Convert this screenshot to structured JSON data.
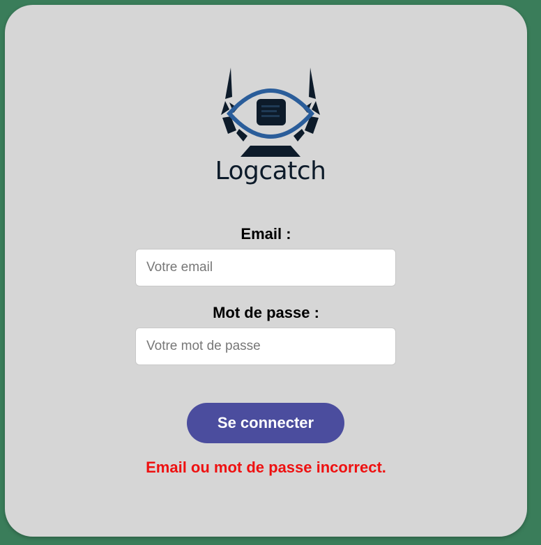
{
  "brand": {
    "name": "Logcatch",
    "logo_icon": "eye-horns-logo-icon",
    "colors": {
      "dark": "#0d1b2a",
      "accent": "#2a5d9a"
    }
  },
  "form": {
    "email_label": "Email :",
    "email_value": "",
    "email_placeholder": "Votre email",
    "password_label": "Mot de passe :",
    "password_value": "",
    "password_placeholder": "Votre mot de passe",
    "submit_label": "Se connecter",
    "error_message": "Email ou mot de passe incorrect."
  },
  "theme": {
    "background": "#3a7d5a",
    "card": "#d6d6d6",
    "button": "#4b4d9e",
    "error": "#ee1111"
  }
}
